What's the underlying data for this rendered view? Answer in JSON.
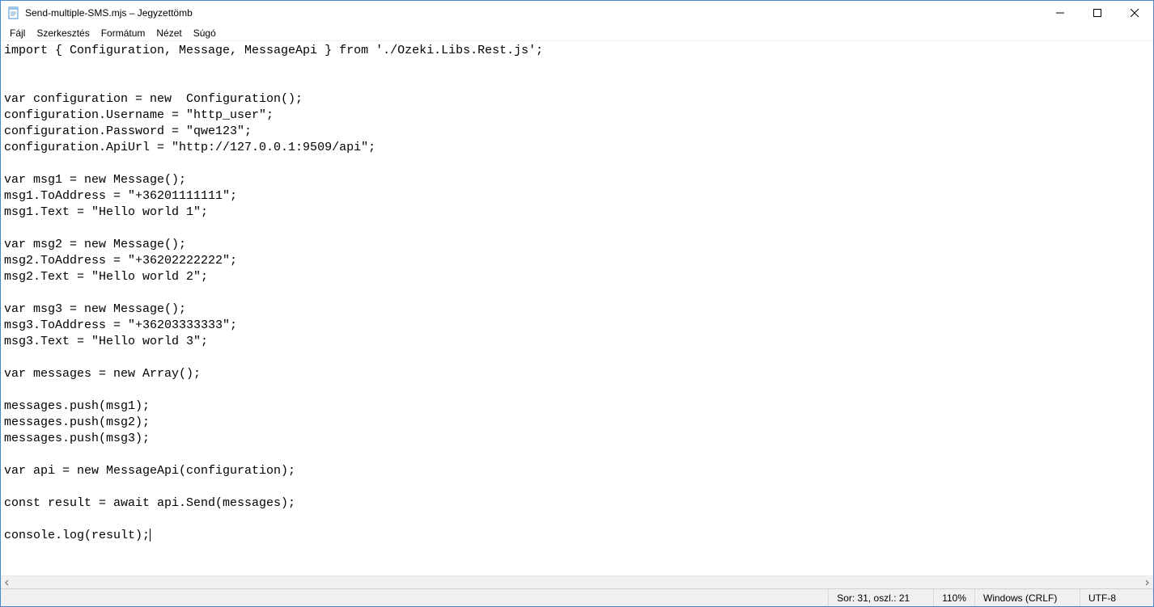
{
  "window": {
    "title": "Send-multiple-SMS.mjs – Jegyzettömb"
  },
  "menu": {
    "file": "Fájl",
    "edit": "Szerkesztés",
    "format": "Formátum",
    "view": "Nézet",
    "help": "Súgó"
  },
  "code": "import { Configuration, Message, MessageApi } from './Ozeki.Libs.Rest.js';\n\n\nvar configuration = new  Configuration();\nconfiguration.Username = \"http_user\";\nconfiguration.Password = \"qwe123\";\nconfiguration.ApiUrl = \"http://127.0.0.1:9509/api\";\n\nvar msg1 = new Message();\nmsg1.ToAddress = \"+36201111111\";\nmsg1.Text = \"Hello world 1\";\n\nvar msg2 = new Message();\nmsg2.ToAddress = \"+36202222222\";\nmsg2.Text = \"Hello world 2\";\n\nvar msg3 = new Message();\nmsg3.ToAddress = \"+36203333333\";\nmsg3.Text = \"Hello world 3\";\n\nvar messages = new Array();\n\nmessages.push(msg1);\nmessages.push(msg2);\nmessages.push(msg3);\n\nvar api = new MessageApi(configuration);\n\nconst result = await api.Send(messages);\n\nconsole.log(result);",
  "status": {
    "position": "Sor: 31, oszl.: 21",
    "zoom": "110%",
    "line_ending": "Windows (CRLF)",
    "encoding": "UTF-8"
  },
  "cursor": {
    "line": 31,
    "col": 21
  }
}
